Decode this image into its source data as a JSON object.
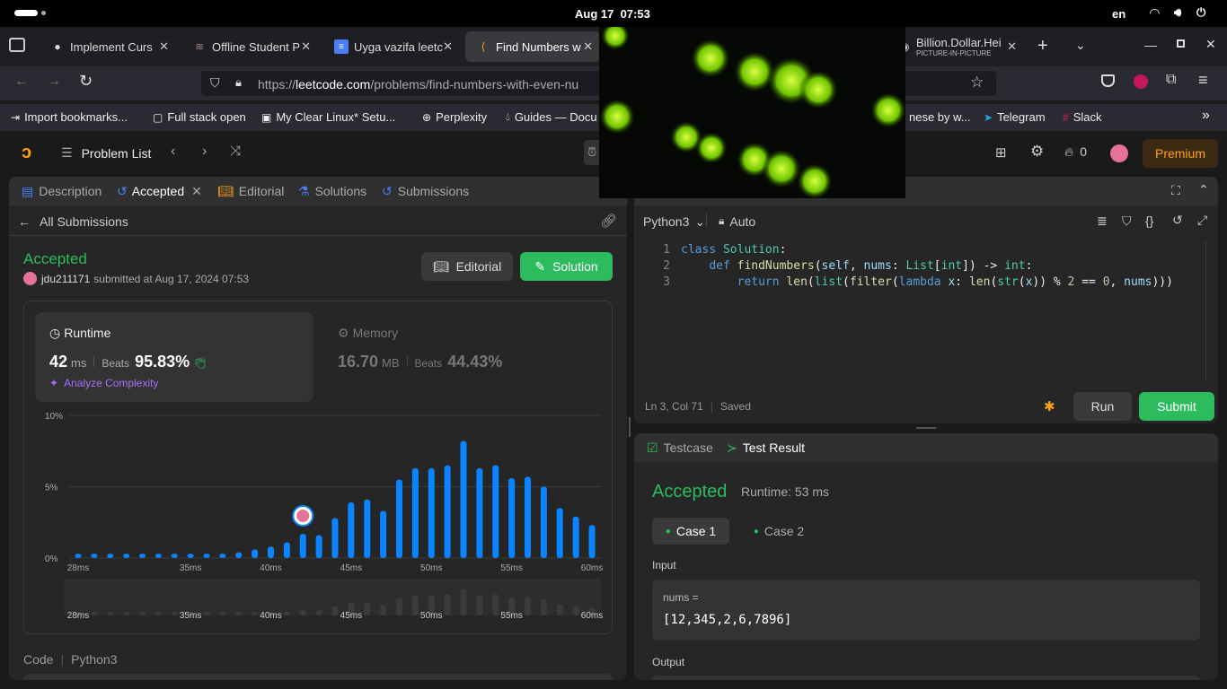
{
  "system": {
    "date_time": "Aug 17  07:53",
    "lang": "en"
  },
  "tabs": [
    {
      "title": "Implement Curs",
      "icon": "github-icon"
    },
    {
      "title": "Offline Student P",
      "icon": "bird-icon"
    },
    {
      "title": "Uyga vazifa leetc",
      "icon": "docs-icon"
    },
    {
      "title": "Find Numbers w",
      "icon": "leetcode-icon"
    },
    {
      "title": "Billion.Dollar.Hei",
      "subtitle": "PICTURE-IN-PICTURE",
      "icon": "pip-icon"
    }
  ],
  "url": {
    "prefix": "https://",
    "domain": "leetcode.com",
    "path": "/problems/find-numbers-with-even-nu"
  },
  "bookmarks": [
    "Import bookmarks...",
    "Full stack open",
    "My Clear Linux* Setu...",
    "Perplexity",
    "Guides — Docu",
    "nese by w...",
    "Telegram",
    "Slack"
  ],
  "header": {
    "problem_list": "Problem List",
    "streak": "0",
    "premium": "Premium"
  },
  "left_tabs": [
    "Description",
    "Accepted",
    "Editorial",
    "Solutions",
    "Submissions"
  ],
  "submission": {
    "back_label": "All Submissions",
    "status": "Accepted",
    "user": "jdu211171",
    "submitted": "submitted at Aug 17, 2024 07:53",
    "editorial_btn": "Editorial",
    "solution_btn": "Solution",
    "runtime_label": "Runtime",
    "runtime_value": "42",
    "runtime_unit": "ms",
    "beats_label": "Beats",
    "runtime_beats": "95.83%",
    "analyze": "Analyze Complexity",
    "memory_label": "Memory",
    "memory_value": "16.70",
    "memory_unit": "MB",
    "memory_beats": "44.43%",
    "code_label": "Code",
    "code_lang": "Python3"
  },
  "chart_data": {
    "type": "bar",
    "ylabel_ticks": [
      "10%",
      "5%",
      "0%"
    ],
    "ylim": [
      0,
      10
    ],
    "x_ticks": [
      "28ms",
      "35ms",
      "40ms",
      "45ms",
      "50ms",
      "55ms",
      "60ms"
    ],
    "x": [
      28,
      29,
      30,
      31,
      32,
      33,
      34,
      35,
      36,
      37,
      38,
      39,
      40,
      41,
      42,
      43,
      44,
      45,
      46,
      47,
      48,
      49,
      50,
      51,
      52,
      53,
      54,
      55,
      56,
      57,
      58,
      59,
      60
    ],
    "values": [
      0.3,
      0.3,
      0.3,
      0.3,
      0.3,
      0.3,
      0.3,
      0.3,
      0.3,
      0.3,
      0.4,
      0.6,
      0.8,
      1.1,
      1.7,
      1.6,
      2.8,
      3.9,
      4.1,
      3.3,
      5.5,
      6.3,
      6.3,
      6.5,
      8.2,
      6.3,
      6.5,
      5.6,
      5.7,
      5.0,
      3.5,
      2.9,
      2.3
    ],
    "highlight_x": 42,
    "grid": true
  },
  "editor": {
    "language": "Python3",
    "mode": "Auto",
    "lines": [
      {
        "n": "1",
        "text": "class Solution:"
      },
      {
        "n": "2",
        "text": "    def findNumbers(self, nums: List[int]) -> int:"
      },
      {
        "n": "3",
        "text": "        return len(list(filter(lambda x: len(str(x)) % 2 == 0, nums)))"
      }
    ],
    "cursor": "Ln 3, Col 71",
    "saved": "Saved",
    "run": "Run",
    "submit": "Submit"
  },
  "result": {
    "tab_testcase": "Testcase",
    "tab_result": "Test Result",
    "status": "Accepted",
    "runtime": "Runtime: 53 ms",
    "cases": [
      "Case 1",
      "Case 2"
    ],
    "input_label": "Input",
    "param": "nums =",
    "param_value": "[12,345,2,6,7896]",
    "output_label": "Output"
  }
}
